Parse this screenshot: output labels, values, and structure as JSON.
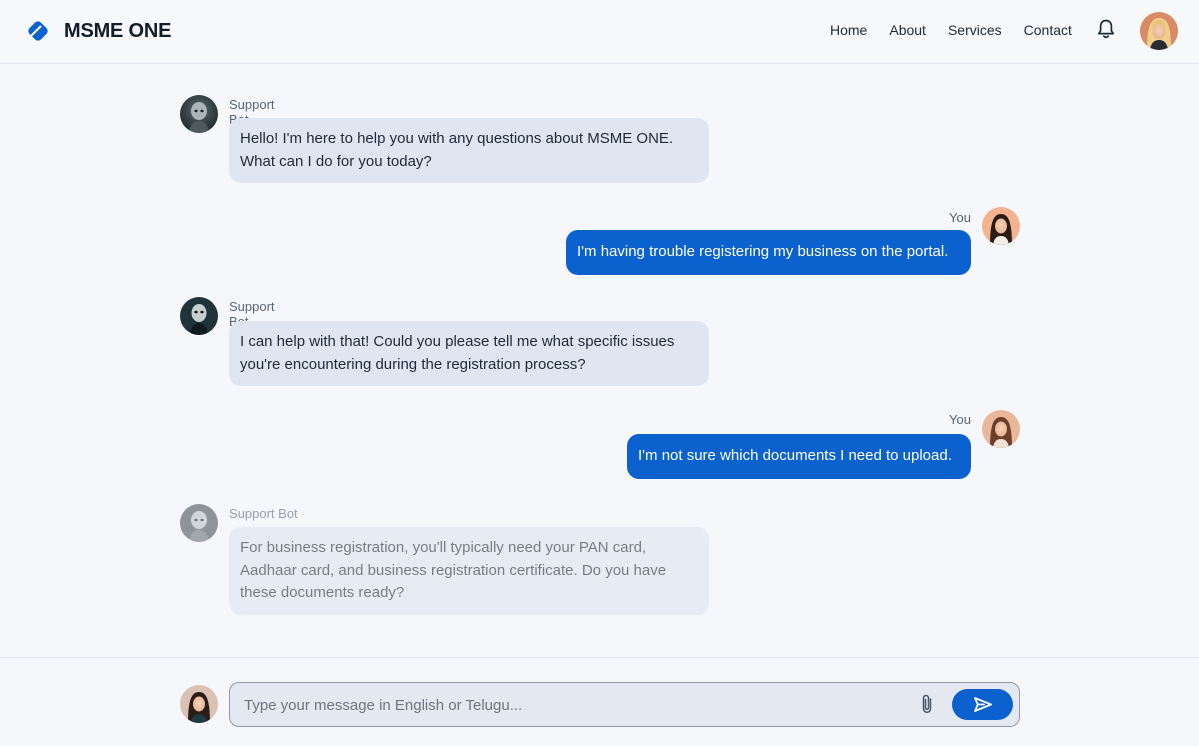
{
  "header": {
    "brand": "MSME ONE",
    "nav": [
      "Home",
      "About",
      "Services",
      "Contact"
    ],
    "icons": {
      "logo": "diamond-logo-icon",
      "notifications": "bell-icon",
      "profile": "user-avatar"
    }
  },
  "messages": [
    {
      "sender": "Support Bot",
      "role": "bot",
      "text_lines": [
        "Hello! I'm here to help you with any questions about MSME ONE.",
        "What can I do for you today?"
      ]
    },
    {
      "sender": "You",
      "role": "user",
      "text_lines": [
        "I'm having trouble registering my business on the portal."
      ]
    },
    {
      "sender": "Support Bot",
      "role": "bot",
      "text_lines": [
        "I can help with that! Could you please tell me what specific issues",
        "you're encountering during the registration process?"
      ]
    },
    {
      "sender": "You",
      "role": "user",
      "text_lines": [
        "I'm not sure which documents I need to upload."
      ]
    },
    {
      "sender": "Support Bot",
      "role": "bot",
      "text_lines": [
        "For business registration, you'll typically need your PAN card,",
        "Aadhaar card, and business registration certificate. Do you have",
        "these documents ready?"
      ]
    }
  ],
  "composer": {
    "placeholder": "Type your message in English or Telugu...",
    "value": "",
    "icons": {
      "attach": "paperclip-icon",
      "send": "send-icon"
    }
  },
  "colors": {
    "accent": "#0b62cf",
    "bot_bubble": "#dfe6f1",
    "page_background": "#f5f7fa"
  }
}
